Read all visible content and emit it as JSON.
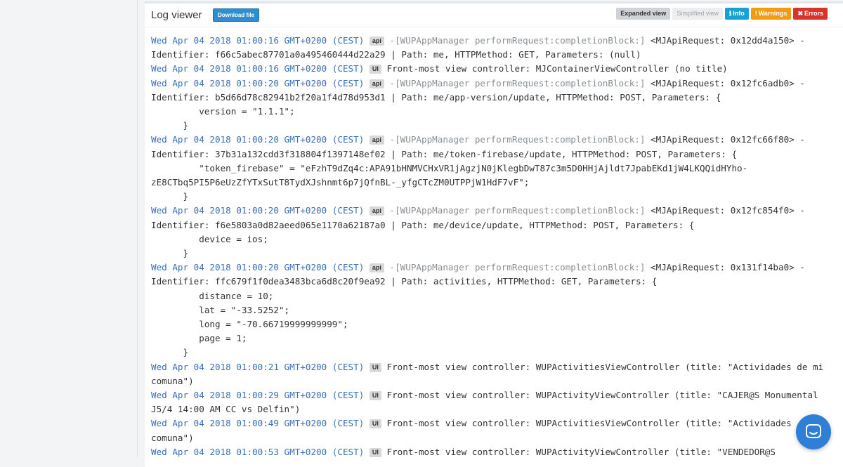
{
  "panel": {
    "title": "Log viewer",
    "download_label": "Download file",
    "toggles": {
      "expanded": "Expanded view",
      "simplified": "Simplified view",
      "info": "Info",
      "warnings": "Warnings",
      "errors": "Errors"
    }
  },
  "log": {
    "lines": [
      {
        "ts": "Wed Apr 04 2018 01:00:16 GMT+0200 (CEST)",
        "badge": "api",
        "src": "-[WUPAppManager performRequest:completionBlock:]",
        "msg": " <MJApiRequest: 0x12dd4a150> -"
      },
      {
        "msg": "Identifier: f66c5abec87701a0a495460444d22a29 | Path: me, HTTPMethod: GET, Parameters: (null)"
      },
      {
        "ts": "Wed Apr 04 2018 01:00:16 GMT+0200 (CEST)",
        "badge": "UI",
        "msg": "Front-most view controller: MJContainerViewController (no title)"
      },
      {
        "ts": "Wed Apr 04 2018 01:00:20 GMT+0200 (CEST)",
        "badge": "api",
        "src": "-[WUPAppManager performRequest:completionBlock:]",
        "msg": " <MJApiRequest: 0x12fc6adb0> -"
      },
      {
        "msg": "Identifier: b5d66d78c82941b2f20a1f4d78d953d1 | Path: me/app-version/update, HTTPMethod: POST, Parameters: {"
      },
      {
        "msg": "         version = \"1.1.1\";"
      },
      {
        "msg": "      }"
      },
      {
        "ts": "Wed Apr 04 2018 01:00:20 GMT+0200 (CEST)",
        "badge": "api",
        "src": "-[WUPAppManager performRequest:completionBlock:]",
        "msg": " <MJApiRequest: 0x12fc66f80> -"
      },
      {
        "msg": "Identifier: 37b31a132cdd3f318804f1397148ef02 | Path: me/token-firebase/update, HTTPMethod: POST, Parameters: {"
      },
      {
        "msg": "         \"token_firebase\" = \"eFzhT9dZq4c:APA91bHNMVCHxVR1jAgzjN0jKlegbDwT87c3m5D0HHjAjldt7JpabEKd1jW4LKQQidHYho-"
      },
      {
        "msg": "zE8CTbq5PI5P6eUzZfYTxSutT8TydXJshnmt6p7jQfnBL-_yfgCTcZM0UTPPjW1HdF7vF\";"
      },
      {
        "msg": "      }"
      },
      {
        "ts": "Wed Apr 04 2018 01:00:20 GMT+0200 (CEST)",
        "badge": "api",
        "src": "-[WUPAppManager performRequest:completionBlock:]",
        "msg": " <MJApiRequest: 0x12fc854f0> -"
      },
      {
        "msg": "Identifier: f6e5803a0d82aeed065e1170a62187a0 | Path: me/device/update, HTTPMethod: POST, Parameters: {"
      },
      {
        "msg": "         device = ios;"
      },
      {
        "msg": "      }"
      },
      {
        "ts": "Wed Apr 04 2018 01:00:20 GMT+0200 (CEST)",
        "badge": "api",
        "src": "-[WUPAppManager performRequest:completionBlock:]",
        "msg": " <MJApiRequest: 0x131f14ba0> -"
      },
      {
        "msg": "Identifier: ffc679f1f0dea3483bca6d8c20f9ea92 | Path: activities, HTTPMethod: GET, Parameters: {"
      },
      {
        "msg": "         distance = 10;"
      },
      {
        "msg": "         lat = \"-33.5252\";"
      },
      {
        "msg": "         long = \"-70.66719999999999\";"
      },
      {
        "msg": "         page = 1;"
      },
      {
        "msg": "      }"
      },
      {
        "ts": "Wed Apr 04 2018 01:00:21 GMT+0200 (CEST)",
        "badge": "UI",
        "msg": "Front-most view controller: WUPActivitiesViewController (title: \"Actividades de mi"
      },
      {
        "msg": "comuna\")"
      },
      {
        "ts": "Wed Apr 04 2018 01:00:29 GMT+0200 (CEST)",
        "badge": "UI",
        "msg": "Front-most view controller: WUPActivityViewController (title: \"CAJER@S Monumental"
      },
      {
        "msg": "J5/4 14:00 AM CC vs Delfin\")"
      },
      {
        "ts": "Wed Apr 04 2018 01:00:49 GMT+0200 (CEST)",
        "badge": "UI",
        "msg": "Front-most view controller: WUPActivitiesViewController (title: \"Actividades"
      },
      {
        "msg": "comuna\")"
      },
      {
        "ts": "Wed Apr 04 2018 01:00:53 GMT+0200 (CEST)",
        "badge": "UI",
        "msg": "Front-most view controller: WUPActivityViewController (title: \"VENDEDOR@S"
      }
    ]
  },
  "chat": {
    "icon": "chat-bubble-icon"
  },
  "colors": {
    "timestamp": "#3a6fb5",
    "download": "#2d8fcf",
    "info": "#17a2d6",
    "warnings": "#f39c12",
    "errors": "#d9332c",
    "chat": "#2f7fd6"
  }
}
